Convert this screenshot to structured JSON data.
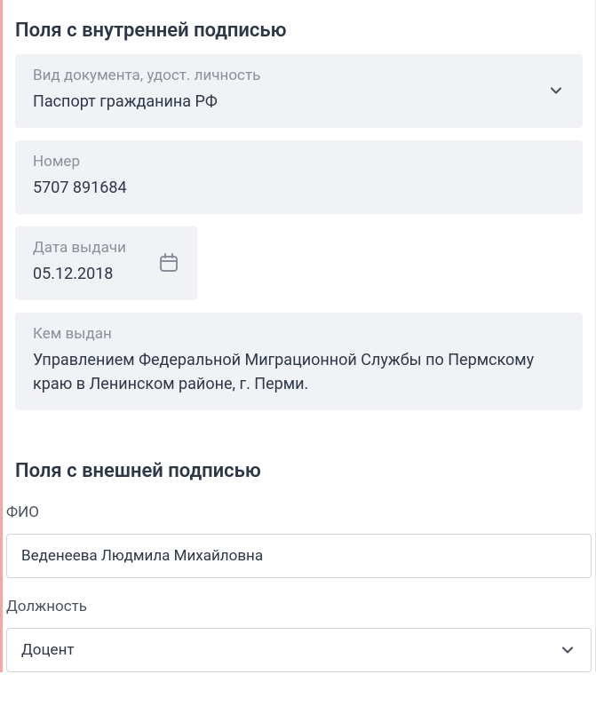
{
  "section_internal": {
    "title": "Поля с внутренней подписью",
    "doc_type": {
      "label": "Вид документа, удост. личность",
      "value": "Паспорт гражданина РФ"
    },
    "number": {
      "label": "Номер",
      "value": "5707 891684"
    },
    "issue_date": {
      "label": "Дата выдачи",
      "value": "05.12.2018"
    },
    "issued_by": {
      "label": "Кем выдан",
      "value": "Управлением Федеральной Миграционной Службы по Пермскому краю в Ленинском районе, г. Перми."
    }
  },
  "section_external": {
    "title": "Поля с внешней подписью",
    "fio": {
      "label": "ФИО",
      "value": "Веденеева Людмила Михайловна"
    },
    "position": {
      "label": "Должность",
      "value": "Доцент"
    }
  }
}
